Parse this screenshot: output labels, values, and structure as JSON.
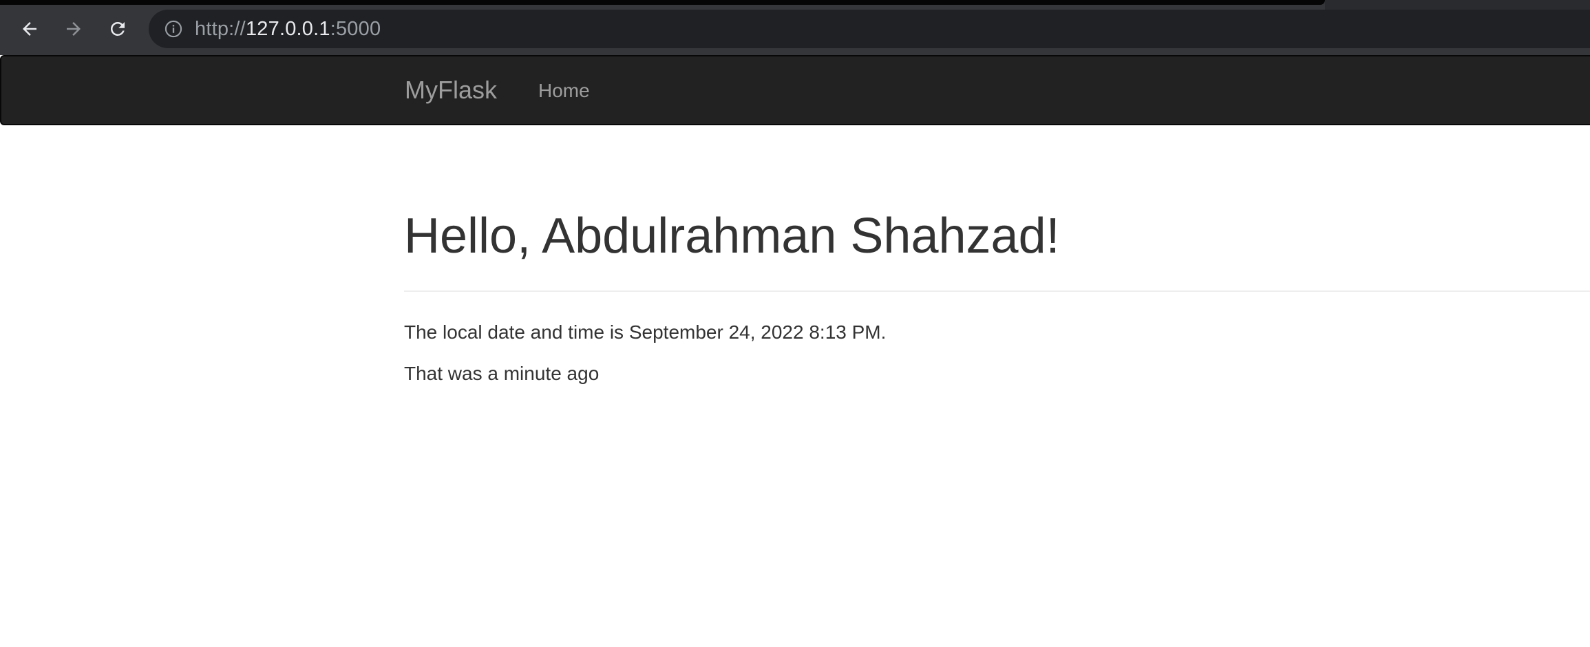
{
  "browser": {
    "url_scheme": "http://",
    "url_host": "127.0.0.1",
    "url_port": ":5000",
    "icons": {
      "back": "back-arrow-icon",
      "forward": "forward-arrow-icon",
      "reload": "reload-icon",
      "site_info": "info-icon"
    },
    "colors": {
      "chrome_bg": "#35363a",
      "omnibox_bg": "#202124",
      "url_dim": "#9aa0a6",
      "url_bright": "#e8eaed"
    }
  },
  "navbar": {
    "brand": "MyFlask",
    "links": [
      {
        "label": "Home"
      }
    ],
    "colors": {
      "background": "#222222",
      "text": "#9d9d9d"
    }
  },
  "main": {
    "heading": "Hello, Abdulrahman Shahzad!",
    "local_time_text": "The local date and time is September 24, 2022 8:13 PM.",
    "relative_time_text": "That was a minute ago",
    "colors": {
      "text": "#333333",
      "divider": "#eeeeee"
    }
  }
}
